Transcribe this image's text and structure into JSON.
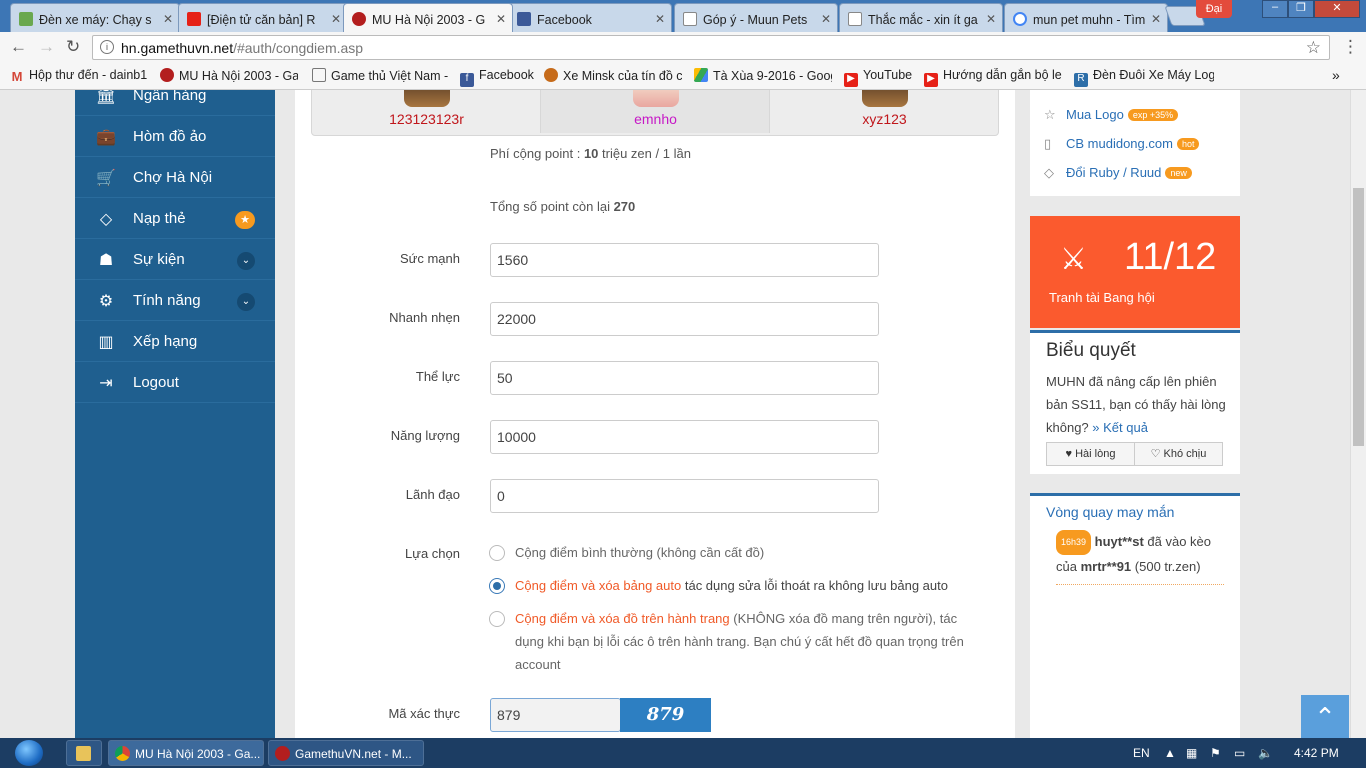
{
  "browser": {
    "tabs": [
      {
        "label": "Đèn xe máy: Chạy s",
        "icon_color": "#6aa84f"
      },
      {
        "label": "[Điện tử căn bản] R",
        "icon_color": "#e62117"
      },
      {
        "label": "MU Hà Nội 2003 - G",
        "icon_color": "#b31e1e",
        "active": true
      },
      {
        "label": "Facebook",
        "icon_color": "#3b5998"
      },
      {
        "label": "Góp ý - Muun Pets",
        "icon_color": "#ffffff"
      },
      {
        "label": "Thắc mắc - xin ít ga",
        "icon_color": "#ffffff"
      },
      {
        "label": "mun pet muhn - Tìm",
        "icon_color": "#4285f4"
      }
    ],
    "profile_label": "Đại",
    "url_host": "hn.gamethuvn.net",
    "url_path": "/#auth/congdiem.asp",
    "bookmarks": [
      {
        "label": "Hộp thư đến - dainb1",
        "icon": "gmail-icon"
      },
      {
        "label": "MU Hà Nội 2003 - Ga",
        "icon": "mu-icon"
      },
      {
        "label": "Game thủ Việt Nam - ",
        "icon": "page-icon"
      },
      {
        "label": "Facebook",
        "icon": "facebook-icon"
      },
      {
        "label": "Xe Minsk của tín đồ c",
        "icon": "minsk-icon"
      },
      {
        "label": "Tà Xùa 9-2016 - Goog",
        "icon": "drive-icon"
      },
      {
        "label": "YouTube",
        "icon": "youtube-icon"
      },
      {
        "label": "Hướng dẫn gắn bộ lei",
        "icon": "youtube-icon"
      },
      {
        "label": "Đèn Đuôi Xe Máy Log",
        "icon": "site-icon"
      }
    ]
  },
  "sidebar": {
    "items": [
      {
        "label": "Ngân hàng",
        "icon": "bank-icon",
        "glyph": "🏛"
      },
      {
        "label": "Hòm đồ ảo",
        "icon": "briefcase-icon",
        "glyph": "💼"
      },
      {
        "label": "Chợ Hà Nội",
        "icon": "cart-icon",
        "glyph": "🛒"
      },
      {
        "label": "Nạp thẻ",
        "icon": "diamond-icon",
        "glyph": "◇",
        "badge": "★"
      },
      {
        "label": "Sự kiện",
        "icon": "android-icon",
        "glyph": "☗",
        "chevron": "⌄"
      },
      {
        "label": "Tính năng",
        "icon": "cogs-icon",
        "glyph": "⚙",
        "chevron": "⌄"
      },
      {
        "label": "Xếp hạng",
        "icon": "bar-chart-icon",
        "glyph": "▥"
      },
      {
        "label": "Logout",
        "icon": "logout-icon",
        "glyph": "⇥"
      }
    ]
  },
  "characters": [
    {
      "name": "123123123r",
      "color": "#c0161b"
    },
    {
      "name": "emnho",
      "color": "#c619c6"
    },
    {
      "name": "xyz123",
      "color": "#c0161b"
    }
  ],
  "form": {
    "fee_prefix": "Phí cộng point : ",
    "fee_value": "10",
    "fee_suffix": " triệu zen / 1 lần",
    "total_prefix": "Tổng số point còn lại ",
    "total_value": "270",
    "fields": [
      {
        "label": "Sức mạnh",
        "value": "1560"
      },
      {
        "label": "Nhanh nhẹn",
        "value": "22000"
      },
      {
        "label": "Thể lực",
        "value": "50"
      },
      {
        "label": "Năng lượng",
        "value": "10000"
      },
      {
        "label": "Lãnh đạo",
        "value": "0"
      }
    ],
    "choice_label": "Lựa chọn",
    "option1": "Cộng điểm bình thường (không cần cất đồ)",
    "option2_highlight": "Cộng điểm và xóa bảng auto",
    "option2_rest": " tác dụng sửa lỗi thoát ra không lưu bảng auto",
    "option3_highlight": "Cộng điểm và xóa đồ trên hành trang",
    "option3_rest": " (KHÔNG xóa đồ mang trên người), tác dụng khi bạn bị lỗi các ô trên hành trang. Bạn chú ý cất hết đồ quan trọng trên account",
    "captcha_label": "Mã xác thực",
    "captcha_value": "879",
    "captcha_image_text": "879"
  },
  "right_panel": {
    "links": [
      {
        "label": "Mua Logo",
        "icon": "star-outline-icon",
        "glyph": "☆",
        "badge": "exp +35%"
      },
      {
        "label": "CB mudidong.com",
        "icon": "mobile-icon",
        "glyph": "▯",
        "badge": "hot"
      },
      {
        "label": "Đổi Ruby / Ruud",
        "icon": "gem-icon",
        "glyph": "◇",
        "badge": "new"
      }
    ],
    "guild_count": "11/12",
    "guild_label": "Tranh tài Bang hội",
    "poll_title": "Biểu quyết",
    "poll_text": "MUHN đã nâng cấp lên phiên bản SS11, bạn có thấy hài lòng không?",
    "poll_result_link": "» Kết quả",
    "poll_yes": "Hài lòng",
    "poll_no": "Khó chịu",
    "wheel_title": "Vòng quay may mắn",
    "wheel_time": "16h39",
    "wheel_user": "huyt**st",
    "wheel_mid": " đã vào kèo của ",
    "wheel_target": "mrtr**91",
    "wheel_amount": " (500 tr.zen)"
  },
  "taskbar": {
    "items": [
      {
        "label": "MU Hà Nội 2003 - Ga...",
        "icon": "chrome-icon"
      },
      {
        "label": "GamethuVN.net - M...",
        "icon": "mu-icon"
      }
    ],
    "lang": "EN",
    "time": "4:42 PM"
  }
}
